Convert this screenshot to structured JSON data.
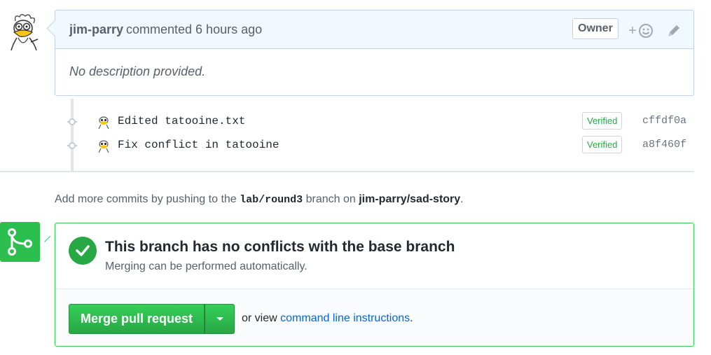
{
  "comment": {
    "author": "jim-parry",
    "action": "commented 6 hours ago",
    "badge": "Owner",
    "reaction_plus": "+",
    "body": "No description provided."
  },
  "commits": [
    {
      "message": "Edited tatooine.txt",
      "verified": "Verified",
      "sha": "cffdf0a"
    },
    {
      "message": "Fix conflict in tatooine",
      "verified": "Verified",
      "sha": "a8f460f"
    }
  ],
  "push_note": {
    "prefix": "Add more commits by pushing to the",
    "branch": "lab/round3",
    "middle": "branch on",
    "repo": "jim-parry/sad-story",
    "suffix": "."
  },
  "merge": {
    "title": "This branch has no conflicts with the base branch",
    "subtitle": "Merging can be performed automatically.",
    "button_label": "Merge pull request",
    "or_view": "or view",
    "cli_link": "command line instructions",
    "period": "."
  },
  "colors": {
    "success": "#28a745",
    "link": "#0366d6",
    "header_bg": "#f1f8ff"
  },
  "icons": [
    "avatar-bird",
    "smiley-icon",
    "pencil-icon",
    "commit-dot-icon",
    "merge-icon",
    "check-icon",
    "caret-down-icon"
  ]
}
